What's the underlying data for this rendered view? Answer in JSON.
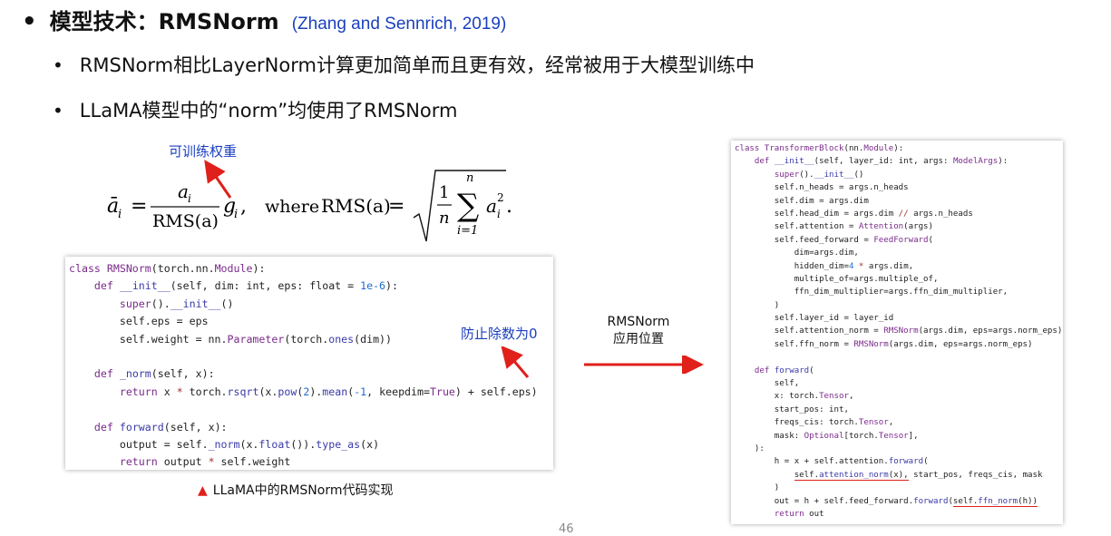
{
  "title": {
    "bullet": "•",
    "text": "模型技术：RMSNorm",
    "citation": "(Zhang and Sennrich, 2019)"
  },
  "bullets": [
    "RMSNorm相比LayerNorm计算更加简单而且更有效，经常被用于大模型训练中",
    "LLaMA模型中的“norm”均使用了RMSNorm"
  ],
  "annotations": {
    "trainable_weight": "可训练权重",
    "avoid_div_zero": "防止除数为0",
    "rmsnorm_location": [
      "RMSNorm",
      "应用位置"
    ]
  },
  "formula": {
    "lhs": "ā",
    "subscript_i": "i",
    "equals": "=",
    "numer": "a",
    "denom": "RMS(a)",
    "gain": "g",
    "comma": ",",
    "where": "where",
    "rms": "RMS(a)",
    "one": "1",
    "n": "n",
    "sum": "∑",
    "sum_top": "n",
    "sum_bottom": "i=1",
    "squared": "2",
    "period": "."
  },
  "left_code": [
    "class RMSNorm(torch.nn.Module):",
    "    def __init__(self, dim: int, eps: float = 1e-6):",
    "        super().__init__()",
    "        self.eps = eps",
    "        self.weight = nn.Parameter(torch.ones(dim))",
    "",
    "    def _norm(self, x):",
    "        return x * torch.rsqrt(x.pow(2).mean(-1, keepdim=True) + self.eps)",
    "",
    "    def forward(self, x):",
    "        output = self._norm(x.float()).type_as(x)",
    "        return output * self.weight"
  ],
  "right_code": [
    "class TransformerBlock(nn.Module):",
    "    def __init__(self, layer_id: int, args: ModelArgs):",
    "        super().__init__()",
    "        self.n_heads = args.n_heads",
    "        self.dim = args.dim",
    "        self.head_dim = args.dim // args.n_heads",
    "        self.attention = Attention(args)",
    "        self.feed_forward = FeedForward(",
    "            dim=args.dim,",
    "            hidden_dim=4 * args.dim,",
    "            multiple_of=args.multiple_of,",
    "            ffn_dim_multiplier=args.ffn_dim_multiplier,",
    "        )",
    "        self.layer_id = layer_id",
    "        self.attention_norm = RMSNorm(args.dim, eps=args.norm_eps)",
    "        self.ffn_norm = RMSNorm(args.dim, eps=args.norm_eps)",
    "",
    "    def forward(",
    "        self,",
    "        x: torch.Tensor,",
    "        start_pos: int,",
    "        freqs_cis: torch.Tensor,",
    "        mask: Optional[torch.Tensor],",
    "    ):",
    "        h = x + self.attention.forward(",
    "            self.attention_norm(x), start_pos, freqs_cis, mask",
    "        )",
    "        out = h + self.feed_forward.forward(self.ffn_norm(h))",
    "        return out"
  ],
  "caption": {
    "marker": "▲",
    "text": "LLaMA中的RMSNorm代码实现"
  },
  "page_number": "46",
  "colors": {
    "accent_blue": "#1a3fbf",
    "arrow_red": "#e0201a"
  }
}
